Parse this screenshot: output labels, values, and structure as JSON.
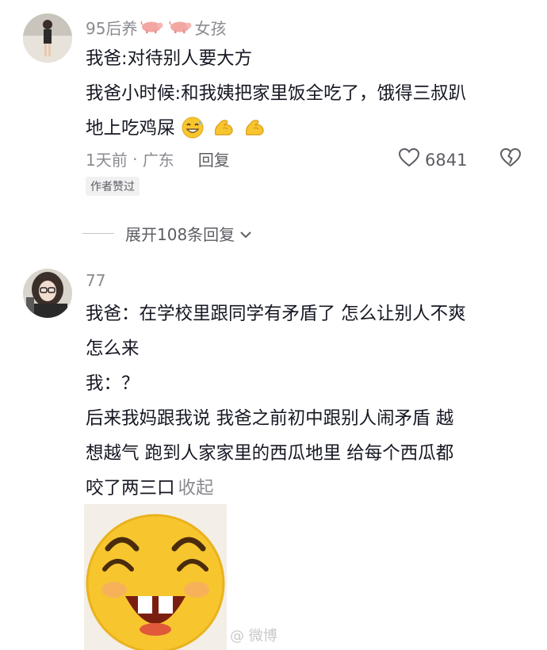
{
  "comments": [
    {
      "username": "95后养",
      "username_suffix": "女孩",
      "username_emoji": [
        "pig-icon",
        "pig-icon"
      ],
      "lines": [
        "我爸:对待别人要大方",
        "我爸小时候:和我姨把家里饭全吃了，饿得三叔趴",
        "地上吃鸡屎"
      ],
      "inline_emojis": [
        "grin-sweat-emoji-icon",
        "flexed-biceps-icon",
        "flexed-biceps-icon"
      ],
      "meta": {
        "time": "1天前",
        "separator": " · ",
        "location": "广东",
        "reply_label": "回复"
      },
      "like_count": "6841",
      "author_tag": "作者赞过",
      "expand_label": "展开108条回复"
    },
    {
      "username": "77",
      "lines": [
        "我爸：在学校里跟同学有矛盾了 怎么让别人不爽",
        "怎么来",
        "我：？",
        "后来我妈跟我说 我爸之前初中跟别人闹矛盾 越",
        "想越气 跑到人家家里的西瓜地里 给每个西瓜都",
        "咬了两三口"
      ],
      "fold_label": "收起",
      "sticker": "laughing-face-sticker"
    }
  ],
  "watermark": "@ 微博",
  "colors": {
    "text": "#161823",
    "secondary": "#8a8b91",
    "sticker_yellow": "#f7c62f"
  }
}
